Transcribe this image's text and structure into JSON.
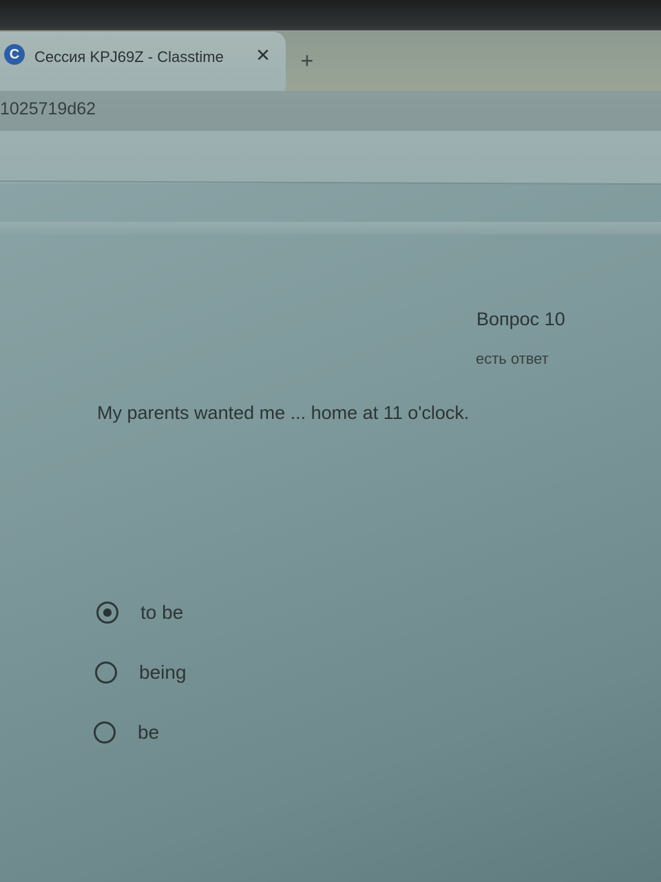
{
  "browser": {
    "tab": {
      "favicon_letter": "C",
      "title": "Сессия KPJ69Z - Classtime",
      "close_symbol": "✕"
    },
    "new_tab_symbol": "+",
    "address_text": "1025719d62"
  },
  "question": {
    "number_label": "Вопрос 10",
    "status_label": "есть ответ",
    "text": "My parents wanted me ... home at 11 o'clock.",
    "options": [
      {
        "label": "to be",
        "selected": true
      },
      {
        "label": "being",
        "selected": false
      },
      {
        "label": "be",
        "selected": false
      }
    ]
  }
}
